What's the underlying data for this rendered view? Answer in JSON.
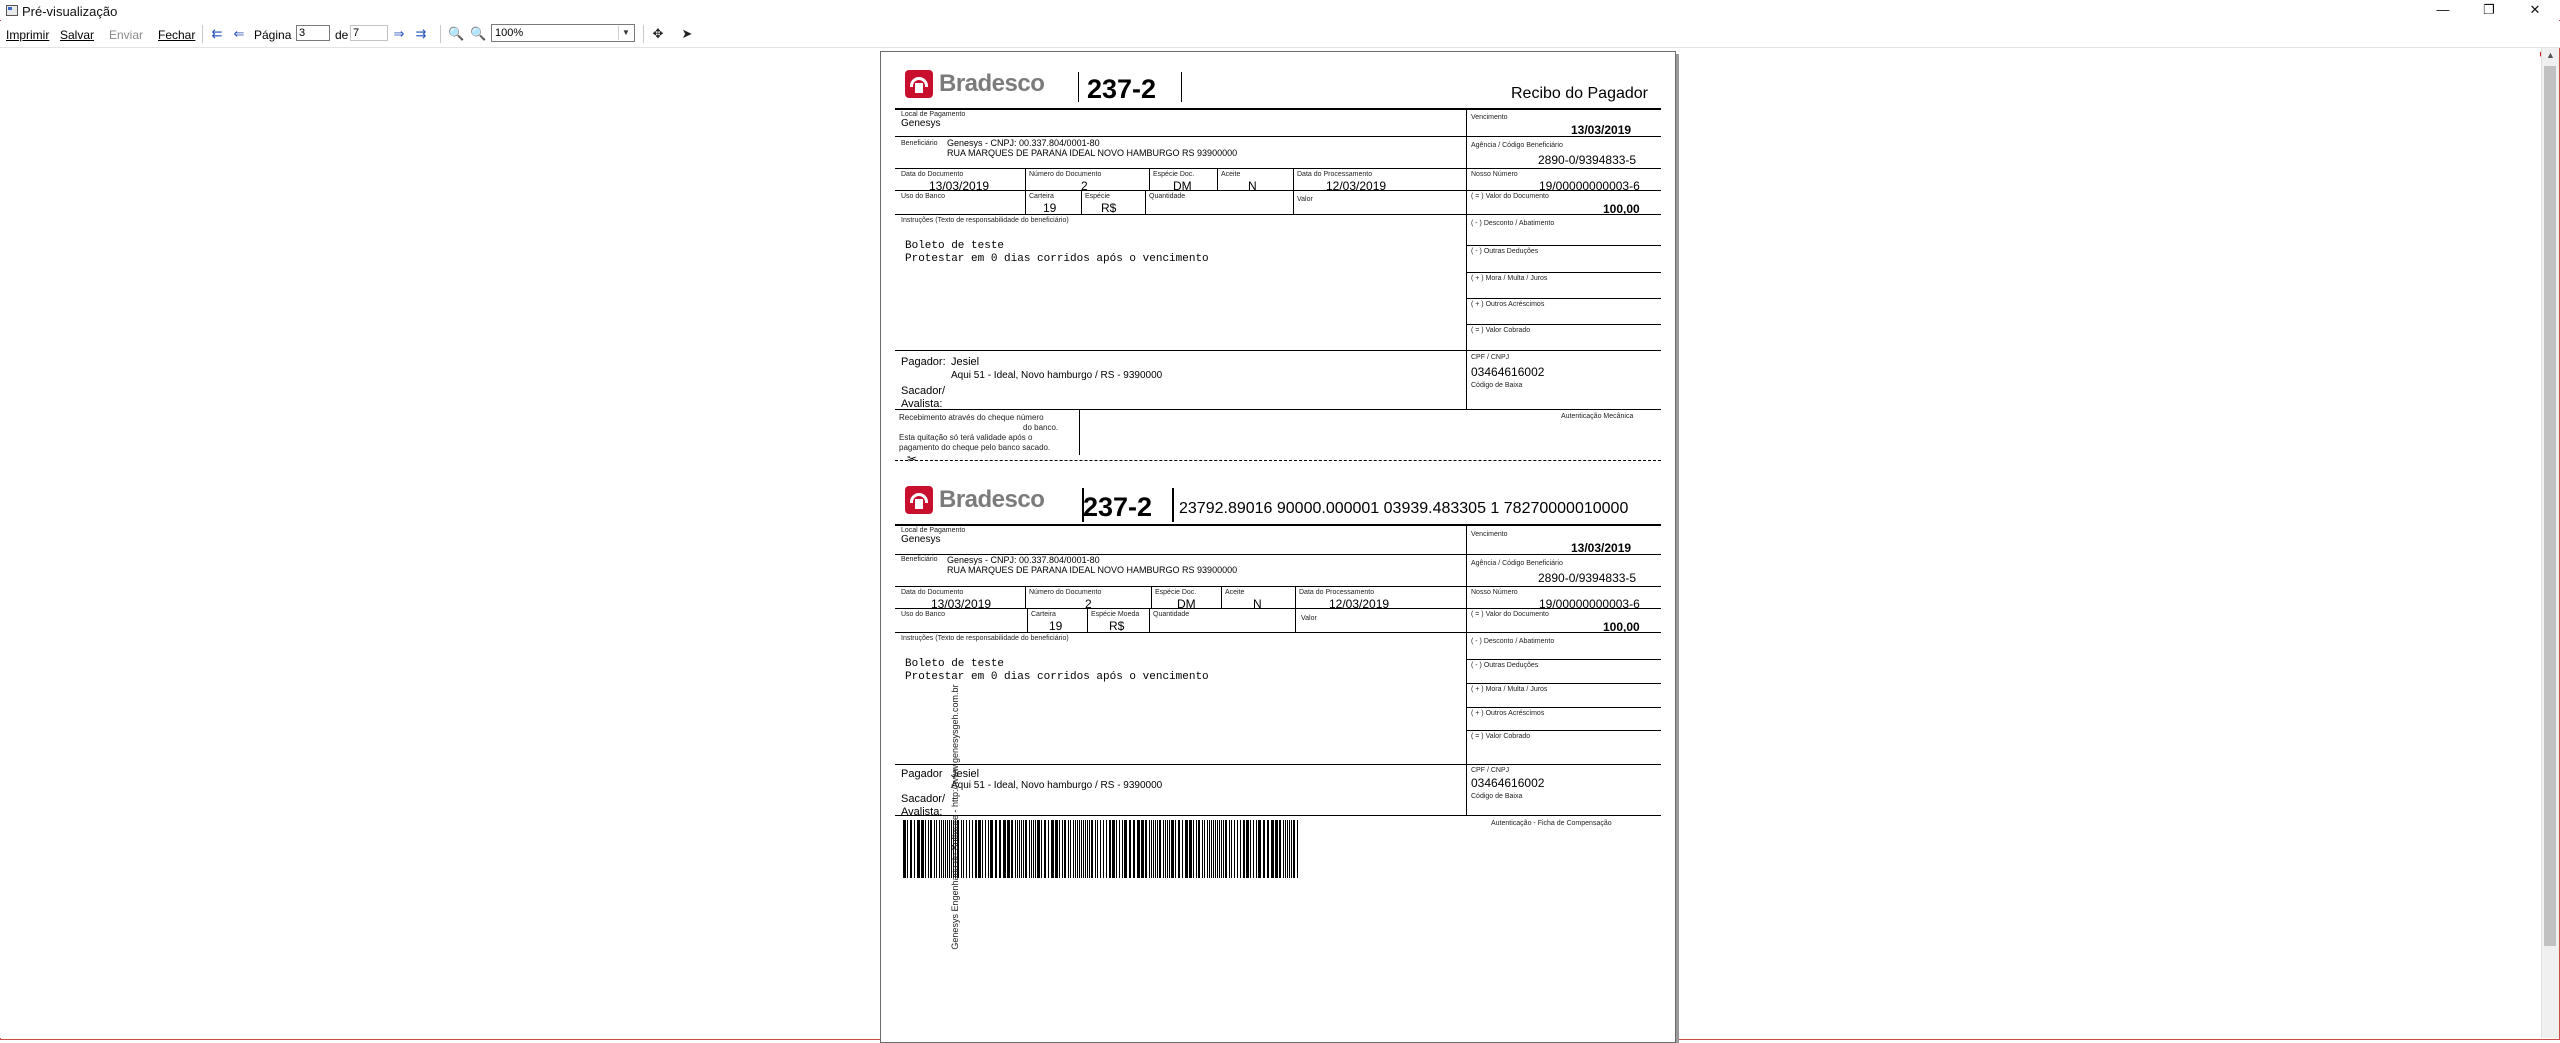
{
  "window": {
    "title": "Pré-visualização",
    "controls": {
      "minimize": "—",
      "maximize": "❐",
      "close": "✕"
    }
  },
  "toolbar": {
    "print": "Imprimir",
    "save": "Salvar",
    "send": "Enviar",
    "close": "Fechar",
    "page_label": "Página",
    "page_current": "3",
    "page_of": "de",
    "page_total": "7",
    "zoom": "100%"
  },
  "receipt": {
    "bank_name": "Bradesco",
    "bank_code": "237-2",
    "title": "Recibo do Pagador",
    "payment_place_label": "Local de Pagamento",
    "payment_place": "Genesys",
    "due_label": "Vencimento",
    "due_date": "13/03/2019",
    "beneficiary_label": "Beneficiário",
    "beneficiary_line1": "Genesys - CNPJ: 00.337.804/0001-80",
    "beneficiary_line2": "RUA MARQUES DE PARANA   IDEAL NOVO HAMBURGO RS 93900000",
    "agency_label": "Agência / Código Beneficiário",
    "agency": "2890-0/9394833-5",
    "doc_date_label": "Data do Documento",
    "doc_date": "13/03/2019",
    "doc_number_label": "Número do Documento",
    "doc_number": "2",
    "doc_kind_label": "Espécie Doc.",
    "doc_kind": "DM",
    "accept_label": "Aceite",
    "accept": "N",
    "process_date_label": "Data do Processamento",
    "process_date": "12/03/2019",
    "our_number_label": "Nosso Número",
    "our_number": "19/00000000003-6",
    "bank_use_label": "Uso do Banco",
    "wallet_label": "Carteira",
    "wallet": "19",
    "currency_label": "Espécie",
    "currency": "R$",
    "quantity_label": "Quantidade",
    "value_label": "Valor",
    "doc_value_label": "( = ) Valor do Documento",
    "doc_value": "100,00",
    "discount_label": "( - ) Desconto / Abatimento",
    "deductions_label": "( - ) Outras Deduções",
    "interest_label": "( + ) Mora / Multa / Juros",
    "additions_label": "( + ) Outros Acréscimos",
    "charged_label": "( = ) Valor Cobrado",
    "instructions_label": "Instruções (Texto de responsabilidade do beneficiário)",
    "instruction1": "Boleto de teste",
    "instruction2": "Protestar em 0 dias corridos após o vencimento",
    "payer_label": "Pagador:",
    "payer_name": "Jesiel",
    "payer_address": "Aqui 51  - Ideal, Novo hamburgo / RS - 9390000",
    "drawer_label": "Sacador/",
    "guarantor_label": "Avalista:",
    "cpf_label": "CPF / CNPJ",
    "cpf": "03464616002",
    "lower_code_label": "Código de Baixa",
    "cheque_line1": "Recebimento através do cheque número",
    "cheque_line2": "do banco.",
    "cheque_line3": "Esta quitação só terá validade após o",
    "cheque_line4": "pagamento do cheque pelo banco sacado.",
    "mechanical_auth_label": "Autenticação Mecânica",
    "scissors": "✂"
  },
  "slip": {
    "bank_name": "Bradesco",
    "bank_code": "237-2",
    "digitable_line": "23792.89016 90000.000001 03939.483305 1 78270000010000",
    "payment_place_label": "Local de Pagamento",
    "payment_place": "Genesys",
    "due_label": "Vencimento",
    "due_date": "13/03/2019",
    "beneficiary_label": "Beneficiário",
    "beneficiary_line1": "Genesys - CNPJ: 00.337.804/0001-80",
    "beneficiary_line2": "RUA MARQUES DE PARANA   IDEAL NOVO HAMBURGO RS 93900000",
    "agency_label": "Agência / Código Beneficiário",
    "agency": "2890-0/9394833-5",
    "doc_date_label": "Data do Documento",
    "doc_date": "13/03/2019",
    "doc_number_label": "Número do Documento",
    "doc_number": "2",
    "doc_kind_label": "Espécie Doc.",
    "doc_kind": "DM",
    "accept_label": "Aceite",
    "accept": "N",
    "process_date_label": "Data do Processamento",
    "process_date": "12/03/2019",
    "our_number_label": "Nosso Número",
    "our_number": "19/00000000003-6",
    "bank_use_label": "Uso do Banco",
    "wallet_label": "Carteira",
    "wallet": "19",
    "currency_label": "Espécie Moeda",
    "currency": "R$",
    "quantity_label": "Quantidade",
    "value_label": "Valor",
    "doc_value_label": "( = ) Valor do Documento",
    "doc_value": "100,00",
    "discount_label": "( - ) Desconto / Abatimento",
    "deductions_label": "( - ) Outras Deduções",
    "interest_label": "( + ) Mora / Multa / Juros",
    "additions_label": "( + ) Outros Acréscimos",
    "charged_label": "( = ) Valor Cobrado",
    "instructions_label": "Instruções (Texto de responsabilidade do beneficiário)",
    "instruction1": "Boleto de teste",
    "instruction2": "Protestar em 0 dias corridos após o vencimento",
    "payer_label": "Pagador",
    "payer_name": "Jesiel",
    "payer_address": "Aqui 51  - Ideal, Novo hamburgo / RS - 9390000",
    "drawer_label": "Sacador/",
    "guarantor_label": "Avalista:",
    "cpf_label": "CPF / CNPJ",
    "cpf": "03464616002",
    "lower_code_label": "Código de Baixa",
    "auth_label": "Autenticação - Ficha de Compensação",
    "side_text": "Genesys Engenharia de Software - http://www.genesysgeh.com.br"
  }
}
